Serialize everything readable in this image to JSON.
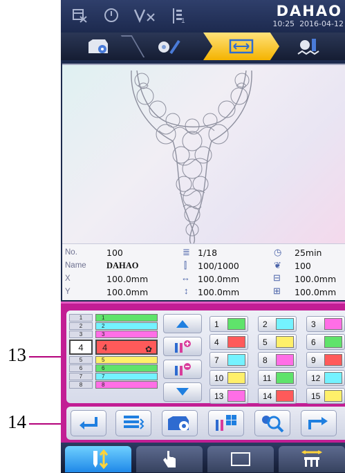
{
  "callouts": {
    "c13": "13",
    "c14": "14"
  },
  "header": {
    "brand": "DAHAO",
    "time": "10:25",
    "date": "2016-04-12",
    "needle_sub": "1"
  },
  "info": {
    "no_label": "No.",
    "no_value": "100",
    "name_label": "Name",
    "name_value": "DAHAO",
    "x_label": "X",
    "x_value": "100.0mm",
    "y_label": "Y",
    "y_value": "100.0mm",
    "colors": "1/18",
    "stitches": "100/1000",
    "width": "100.0mm",
    "height": "100.0mm",
    "time": "25min",
    "speed": "100",
    "frame_w": "100.0mm",
    "frame_h": "100.0mm"
  },
  "needle_rows": [
    {
      "n": "1",
      "c": "1",
      "color": "#5fe36b"
    },
    {
      "n": "2",
      "c": "2",
      "color": "#74f2ff"
    },
    {
      "n": "3",
      "c": "3",
      "color": "#ff6ee6"
    },
    {
      "n": "4",
      "c": "4",
      "color": "#ff5a5a"
    },
    {
      "n": "5",
      "c": "5",
      "color": "#fff06a"
    },
    {
      "n": "6",
      "c": "6",
      "color": "#5fe36b"
    },
    {
      "n": "7",
      "c": "7",
      "color": "#74f2ff"
    },
    {
      "n": "8",
      "c": "8",
      "color": "#ff6ee6"
    }
  ],
  "palette": [
    {
      "label": "1",
      "color": "#5fe36b"
    },
    {
      "label": "2",
      "color": "#74f2ff"
    },
    {
      "label": "3",
      "color": "#ff6ee6"
    },
    {
      "label": "4",
      "color": "#ff5a5a"
    },
    {
      "label": "5",
      "color": "#fff06a"
    },
    {
      "label": "6",
      "color": "#5fe36b"
    },
    {
      "label": "7",
      "color": "#74f2ff"
    },
    {
      "label": "8",
      "color": "#ff6ee6"
    },
    {
      "label": "9",
      "color": "#ff5a5a"
    },
    {
      "label": "10",
      "color": "#fff06a"
    },
    {
      "label": "11",
      "color": "#5fe36b"
    },
    {
      "label": "12",
      "color": "#74f2ff"
    },
    {
      "label": "13",
      "color": "#ff6ee6"
    },
    {
      "label": "14",
      "color": "#ff5a5a"
    },
    {
      "label": "15",
      "color": "#fff06a"
    }
  ],
  "colors": {
    "magenta": "#c21e94",
    "active_step": "#f4b300",
    "nav_active": "#1f88e8"
  }
}
